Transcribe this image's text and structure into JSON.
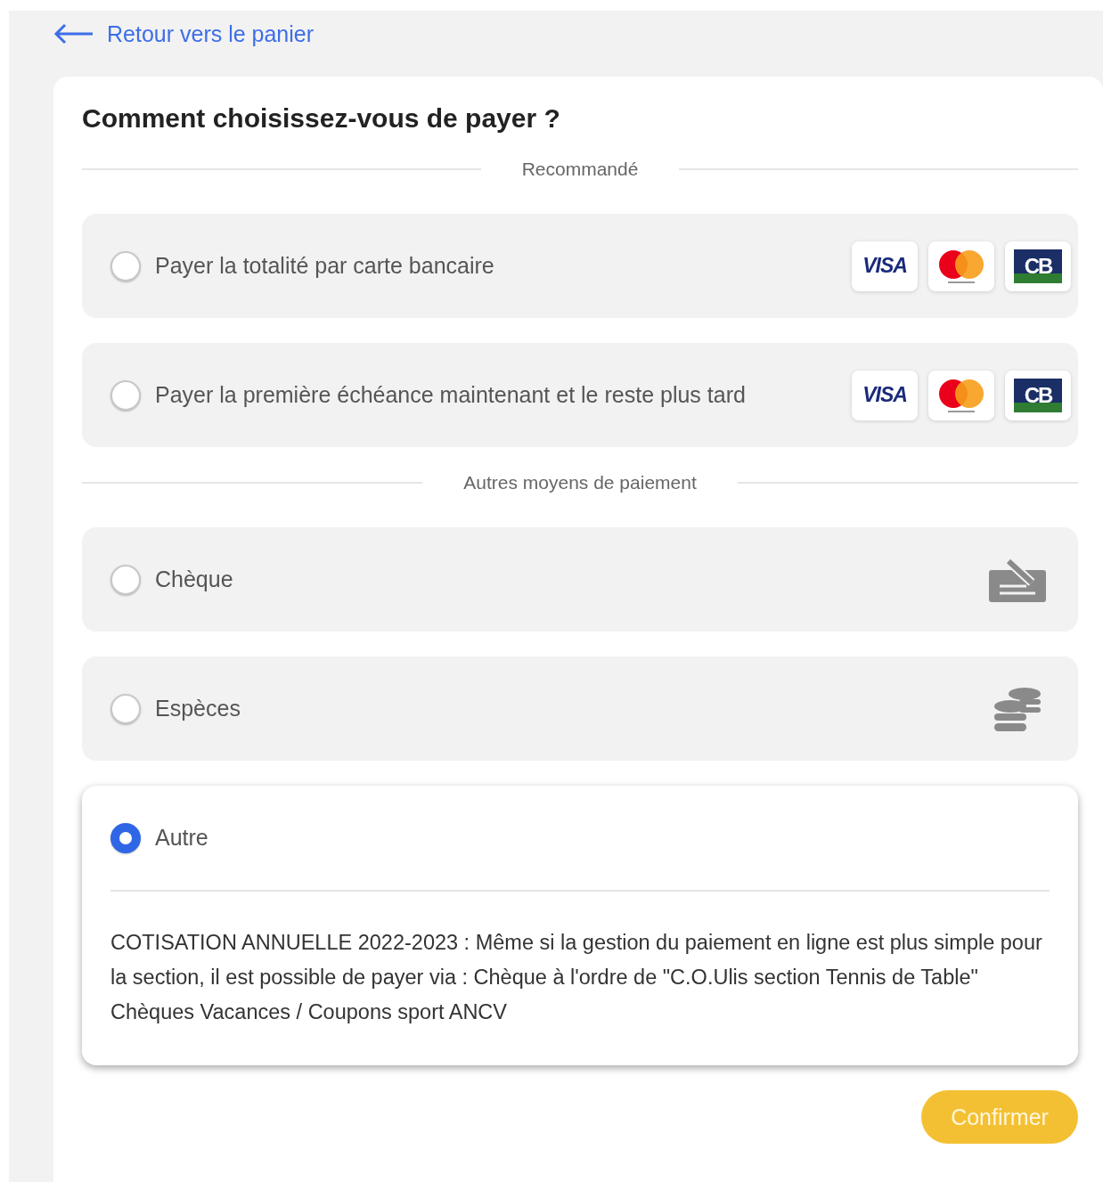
{
  "back_link": {
    "label": "Retour vers le panier"
  },
  "title": "Comment choisissez-vous de payer ?",
  "sections": [
    {
      "heading": "Recommandé",
      "options": [
        {
          "label": "Payer la totalité par carte bancaire",
          "selected": false,
          "kind": "cards",
          "logos": [
            {
              "kind": "visa",
              "text": "VISA"
            },
            {
              "kind": "mastercard"
            },
            {
              "kind": "cb",
              "text": "CB"
            }
          ]
        },
        {
          "label": "Payer la première échéance maintenant et le reste plus tard",
          "selected": false,
          "kind": "cards",
          "logos": [
            {
              "kind": "visa",
              "text": "VISA"
            },
            {
              "kind": "mastercard"
            },
            {
              "kind": "cb",
              "text": "CB"
            }
          ]
        }
      ]
    },
    {
      "heading": "Autres moyens de paiement",
      "options": [
        {
          "label": "Chèque",
          "selected": false,
          "kind": "cheque"
        },
        {
          "label": "Espèces",
          "selected": false,
          "kind": "coins"
        },
        {
          "label": "Autre",
          "selected": true,
          "description": "COTISATION ANNUELLE 2022-2023 : Même si la gestion du paiement en ligne est plus simple pour la section, il est possible de payer via : Chèque à l'ordre de \"C.O.Ulis section Tennis de Table\" Chèques Vacances / Coupons sport ANCV"
        }
      ]
    }
  ],
  "confirm_button": {
    "label": "Confirmer"
  }
}
